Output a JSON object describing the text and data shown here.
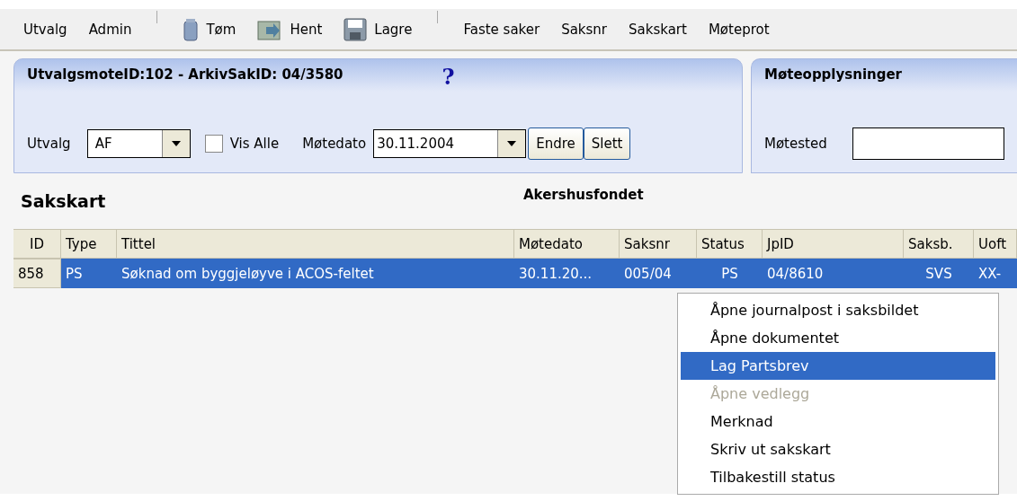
{
  "toolbar": [
    {
      "kind": "text",
      "label": "Utvalg"
    },
    {
      "kind": "text",
      "label": "Admin"
    },
    {
      "kind": "separator"
    },
    {
      "kind": "trash",
      "label": "Tøm"
    },
    {
      "kind": "fetch",
      "label": "Hent"
    },
    {
      "kind": "save",
      "label": "Lagre"
    },
    {
      "kind": "separator"
    },
    {
      "kind": "text",
      "label": "Faste saker"
    },
    {
      "kind": "text",
      "label": "Saksnr"
    },
    {
      "kind": "text",
      "label": "Sakskart"
    },
    {
      "kind": "text",
      "label": "Møteprot"
    }
  ],
  "meeting_panel": {
    "title": "UtvalgsmoteID:102 - ArkivSakID: 04/3580",
    "help": "?",
    "utvalg_label": "Utvalg",
    "utvalg_value": "AF",
    "vis_alle": {
      "label": "Vis Alle",
      "checked": false
    },
    "motedato_label": "Møtedato",
    "motedato_value": "30.11.2004",
    "buttons": [
      "Endre",
      "Slett"
    ]
  },
  "info_panel": {
    "title": "Møteopplysninger",
    "motested_label": "Møtested"
  },
  "section_title": "Sakskart",
  "organisation": "Akershusfondet",
  "table": {
    "columns": [
      "ID",
      "Type",
      "Tittel",
      "Møtedato",
      "Saksnr",
      "Status",
      "JpID",
      "Saksb.",
      "Uoft"
    ],
    "rows": [
      {
        "selected": true,
        "cells": [
          "858",
          "PS",
          "Søknad om byggjeløyve i ACOS-feltet",
          "30.11.20...",
          "005/04",
          "PS",
          "04/8610",
          "SVS",
          "XX-"
        ]
      }
    ]
  },
  "context_menu": [
    {
      "label": "Åpne journalpost i saksbildet",
      "selected": false,
      "disabled": false
    },
    {
      "label": "Åpne dokumentet",
      "selected": false,
      "disabled": false
    },
    {
      "label": "Lag Partsbrev",
      "selected": true,
      "disabled": false
    },
    {
      "label": "Åpne vedlegg",
      "selected": false,
      "disabled": true
    },
    {
      "label": "Merknad",
      "selected": false,
      "disabled": false
    },
    {
      "label": "Skriv ut sakskart",
      "selected": false,
      "disabled": false
    },
    {
      "label": "Tilbakestill status",
      "selected": false,
      "disabled": false
    }
  ]
}
